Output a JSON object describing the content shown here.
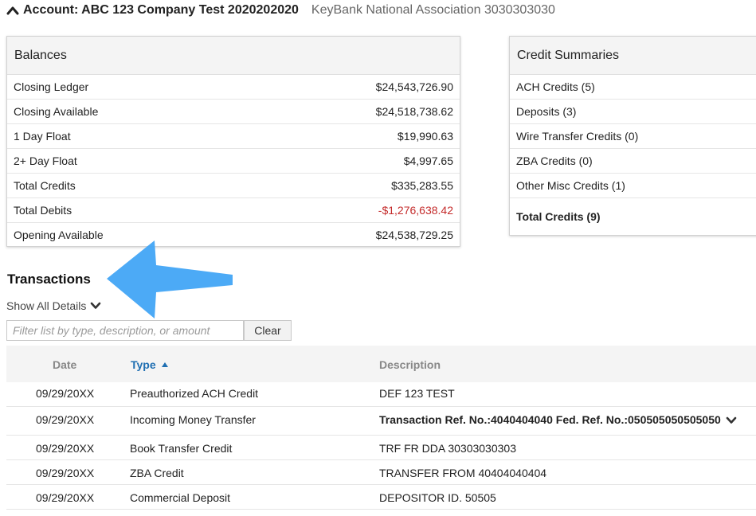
{
  "header": {
    "account_title": "Account: ABC 123 Company Test 2020202020",
    "bank": "KeyBank National Association 3030303030",
    "collapse_icon": "chevron-up-icon"
  },
  "balances": {
    "title": "Balances",
    "rows": [
      {
        "label": "Closing Ledger",
        "value": "$24,543,726.90"
      },
      {
        "label": "Closing Available",
        "value": "$24,518,738.62"
      },
      {
        "label": "1 Day Float",
        "value": "$19,990.63"
      },
      {
        "label": "2+ Day Float",
        "value": "$4,997.65"
      },
      {
        "label": "Total Credits",
        "value": "$335,283.55"
      },
      {
        "label": "Total Debits",
        "value": "-$1,276,638.42"
      },
      {
        "label": "Opening Available",
        "value": "$24,538,729.25"
      }
    ]
  },
  "credit_summaries": {
    "title": "Credit Summaries",
    "rows": [
      {
        "label": "ACH Credits (5)"
      },
      {
        "label": "Deposits (3)"
      },
      {
        "label": "Wire Transfer Credits (0)"
      },
      {
        "label": "ZBA Credits (0)"
      },
      {
        "label": "Other Misc Credits (1)"
      }
    ],
    "total": "Total Credits (9)"
  },
  "transactions": {
    "title": "Transactions",
    "show_all": "Show All Details",
    "filter_placeholder": "Filter list by type, description, or amount",
    "clear_label": "Clear",
    "columns": {
      "date": "Date",
      "type": "Type",
      "description": "Description"
    },
    "sort_icon": "sort-ascending-icon",
    "rows": [
      {
        "date": "09/29/20XX",
        "type": "Preauthorized ACH Credit",
        "description": "DEF 123 TEST"
      },
      {
        "date": "09/29/20XX",
        "type": "Incoming Money Transfer",
        "description": "Transaction Ref. No.:4040404040 Fed. Ref. No.:050505050505050"
      },
      {
        "date": "09/29/20XX",
        "type": "Book Transfer Credit",
        "description": "TRF FR DDA 30303030303"
      },
      {
        "date": "09/29/20XX",
        "type": "ZBA Credit",
        "description": "TRANSFER FROM 40404040404"
      },
      {
        "date": "09/29/20XX",
        "type": "Commercial Deposit",
        "description": "DEPOSITOR ID.  50505"
      }
    ]
  },
  "colors": {
    "accent_link": "#1f6fb2",
    "negative": "#c42b2b",
    "annotation_arrow": "#42a5f5"
  }
}
